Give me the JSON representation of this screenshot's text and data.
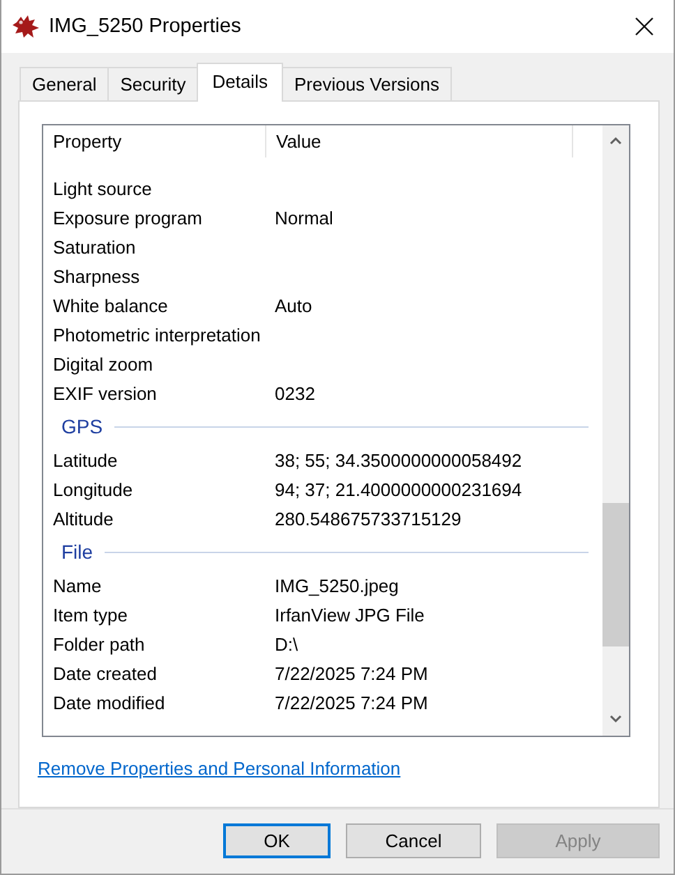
{
  "window": {
    "title": "IMG_5250 Properties"
  },
  "tabs": [
    {
      "label": "General",
      "selected": false
    },
    {
      "label": "Security",
      "selected": false
    },
    {
      "label": "Details",
      "selected": true
    },
    {
      "label": "Previous Versions",
      "selected": false
    }
  ],
  "table": {
    "columns": [
      "Property",
      "Value"
    ],
    "sections": [
      {
        "rows": [
          {
            "property": "Light source"
          },
          {
            "property": "Exposure program",
            "value": "Normal"
          },
          {
            "property": "Saturation"
          },
          {
            "property": "Sharpness"
          },
          {
            "property": "White balance",
            "value": "Auto"
          },
          {
            "property": "Photometric interpretation"
          },
          {
            "property": "Digital zoom"
          },
          {
            "property": "EXIF version",
            "value": "0232"
          }
        ]
      },
      {
        "title": "GPS",
        "rows": [
          {
            "property": "Latitude",
            "value": "38; 55; 34.3500000000058492"
          },
          {
            "property": "Longitude",
            "value": "94; 37; 21.4000000000231694"
          },
          {
            "property": "Altitude",
            "value": "280.548675733715129"
          }
        ]
      },
      {
        "title": "File",
        "rows": [
          {
            "property": "Name",
            "value": "IMG_5250.jpeg"
          },
          {
            "property": "Item type",
            "value": "IrfanView JPG File"
          },
          {
            "property": "Folder path",
            "value": "D:\\"
          },
          {
            "property": "Date created",
            "value": "7/22/2025 7:24 PM"
          },
          {
            "property": "Date modified",
            "value": "7/22/2025 7:24 PM"
          }
        ]
      }
    ]
  },
  "link": "Remove Properties and Personal Information",
  "buttons": [
    {
      "label": "OK",
      "default": true,
      "disabled": false
    },
    {
      "label": "Cancel",
      "default": false,
      "disabled": false
    },
    {
      "label": "Apply",
      "default": false,
      "disabled": true
    }
  ]
}
